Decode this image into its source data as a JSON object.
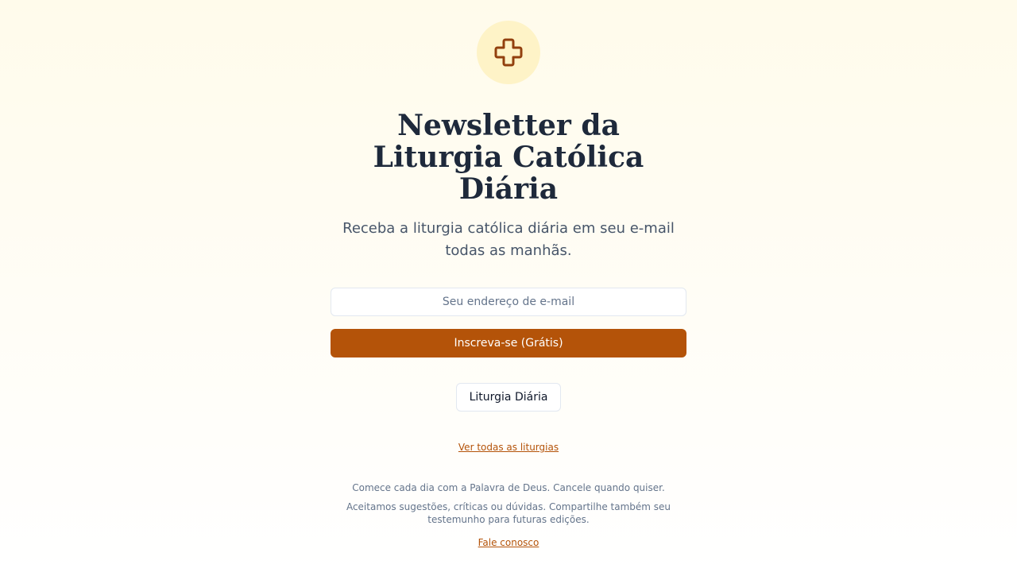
{
  "header": {
    "logo_icon": "cross-icon",
    "title": "Newsletter da Liturgia Católica Diária",
    "subtitle": "Receba a liturgia católica diária em seu e-mail todas as manhãs."
  },
  "form": {
    "email_placeholder": "Seu endereço de e-mail",
    "email_value": "",
    "subscribe_label": "Inscreva-se (Grátis)"
  },
  "nav": {
    "liturgia_button_label": "Liturgia Diária",
    "all_liturgies_link": "Ver todas as liturgias"
  },
  "footer": {
    "tagline": "Comece cada dia com a Palavra de Deus. Cancele quando quiser.",
    "feedback": "Aceitamos sugestões, críticas ou dúvidas. Compartilhe também seu testemunho para futuras edições.",
    "contact_link": "Fale conosco"
  },
  "colors": {
    "accent": "#b45309",
    "logo_bg": "#fef3c7",
    "title": "#1e293b",
    "background": "#fffbeb"
  }
}
